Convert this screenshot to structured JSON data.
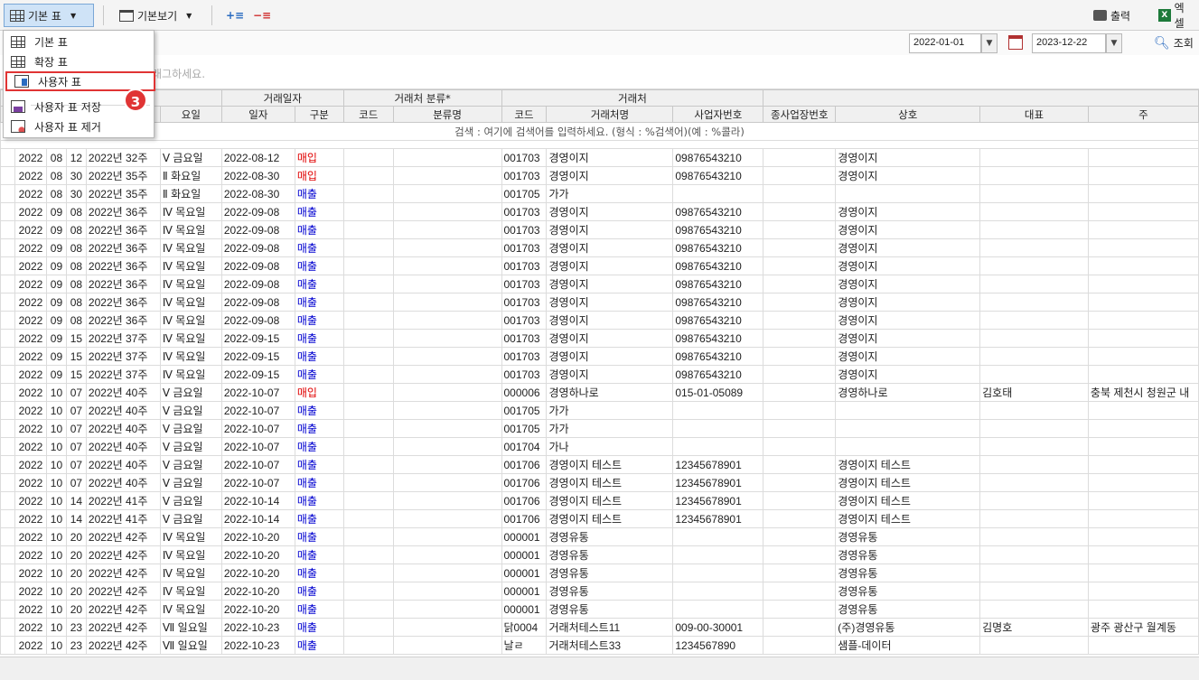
{
  "toolbar": {
    "table_mode_label": "기본 표",
    "view_label": "기본보기",
    "print_label": "출력",
    "excel_label": "엑셀"
  },
  "menu": {
    "items": [
      {
        "label": "기본 표"
      },
      {
        "label": "확장 표"
      },
      {
        "label": "사용자 표"
      },
      {
        "label": "사용자 표 저장"
      },
      {
        "label": "사용자 표 제거"
      }
    ],
    "step_badge": "3"
  },
  "filters": {
    "date_from": "2022-01-01",
    "date_to": "2023-12-22",
    "search_label": "조회"
  },
  "hint_partial": "래그하세요.",
  "grid": {
    "group_headers": {
      "trade_date": "거래일자",
      "partner_category": "거래처 분류*",
      "partner": "거래처"
    },
    "columns": [
      "",
      "",
      "",
      "요일",
      "일자",
      "구분",
      "코드",
      "분류명",
      "코드",
      "거래처명",
      "사업자번호",
      "종사업장번호",
      "상호",
      "대표",
      "주"
    ],
    "search_hint": "검색 : 여기에 검색어를 입력하세요. (형식 : %검색어)(예 : %콜라)",
    "rows": [
      [
        "2022",
        "08",
        "12",
        "2022년 32주",
        "Ⅴ 금요일",
        "2022-08-12",
        "매입",
        "",
        "",
        "001703",
        "경영이지",
        "09876543210",
        "",
        "경영이지",
        "",
        ""
      ],
      [
        "2022",
        "08",
        "30",
        "2022년 35주",
        "Ⅱ 화요일",
        "2022-08-30",
        "매입",
        "",
        "",
        "001703",
        "경영이지",
        "09876543210",
        "",
        "경영이지",
        "",
        ""
      ],
      [
        "2022",
        "08",
        "30",
        "2022년 35주",
        "Ⅱ 화요일",
        "2022-08-30",
        "매출",
        "",
        "",
        "001705",
        "가가",
        "",
        "",
        "",
        "",
        ""
      ],
      [
        "2022",
        "09",
        "08",
        "2022년 36주",
        "Ⅳ 목요일",
        "2022-09-08",
        "매출",
        "",
        "",
        "001703",
        "경영이지",
        "09876543210",
        "",
        "경영이지",
        "",
        ""
      ],
      [
        "2022",
        "09",
        "08",
        "2022년 36주",
        "Ⅳ 목요일",
        "2022-09-08",
        "매출",
        "",
        "",
        "001703",
        "경영이지",
        "09876543210",
        "",
        "경영이지",
        "",
        ""
      ],
      [
        "2022",
        "09",
        "08",
        "2022년 36주",
        "Ⅳ 목요일",
        "2022-09-08",
        "매출",
        "",
        "",
        "001703",
        "경영이지",
        "09876543210",
        "",
        "경영이지",
        "",
        ""
      ],
      [
        "2022",
        "09",
        "08",
        "2022년 36주",
        "Ⅳ 목요일",
        "2022-09-08",
        "매출",
        "",
        "",
        "001703",
        "경영이지",
        "09876543210",
        "",
        "경영이지",
        "",
        ""
      ],
      [
        "2022",
        "09",
        "08",
        "2022년 36주",
        "Ⅳ 목요일",
        "2022-09-08",
        "매출",
        "",
        "",
        "001703",
        "경영이지",
        "09876543210",
        "",
        "경영이지",
        "",
        ""
      ],
      [
        "2022",
        "09",
        "08",
        "2022년 36주",
        "Ⅳ 목요일",
        "2022-09-08",
        "매출",
        "",
        "",
        "001703",
        "경영이지",
        "09876543210",
        "",
        "경영이지",
        "",
        ""
      ],
      [
        "2022",
        "09",
        "08",
        "2022년 36주",
        "Ⅳ 목요일",
        "2022-09-08",
        "매출",
        "",
        "",
        "001703",
        "경영이지",
        "09876543210",
        "",
        "경영이지",
        "",
        ""
      ],
      [
        "2022",
        "09",
        "15",
        "2022년 37주",
        "Ⅳ 목요일",
        "2022-09-15",
        "매출",
        "",
        "",
        "001703",
        "경영이지",
        "09876543210",
        "",
        "경영이지",
        "",
        ""
      ],
      [
        "2022",
        "09",
        "15",
        "2022년 37주",
        "Ⅳ 목요일",
        "2022-09-15",
        "매출",
        "",
        "",
        "001703",
        "경영이지",
        "09876543210",
        "",
        "경영이지",
        "",
        ""
      ],
      [
        "2022",
        "09",
        "15",
        "2022년 37주",
        "Ⅳ 목요일",
        "2022-09-15",
        "매출",
        "",
        "",
        "001703",
        "경영이지",
        "09876543210",
        "",
        "경영이지",
        "",
        ""
      ],
      [
        "2022",
        "10",
        "07",
        "2022년 40주",
        "Ⅴ 금요일",
        "2022-10-07",
        "매입",
        "",
        "",
        "000006",
        "경영하나로",
        "015-01-05089",
        "",
        "경영하나로",
        "김호태",
        "충북 제천시 청원군 내"
      ],
      [
        "2022",
        "10",
        "07",
        "2022년 40주",
        "Ⅴ 금요일",
        "2022-10-07",
        "매출",
        "",
        "",
        "001705",
        "가가",
        "",
        "",
        "",
        "",
        ""
      ],
      [
        "2022",
        "10",
        "07",
        "2022년 40주",
        "Ⅴ 금요일",
        "2022-10-07",
        "매출",
        "",
        "",
        "001705",
        "가가",
        "",
        "",
        "",
        "",
        ""
      ],
      [
        "2022",
        "10",
        "07",
        "2022년 40주",
        "Ⅴ 금요일",
        "2022-10-07",
        "매출",
        "",
        "",
        "001704",
        "가나",
        "",
        "",
        "",
        "",
        ""
      ],
      [
        "2022",
        "10",
        "07",
        "2022년 40주",
        "Ⅴ 금요일",
        "2022-10-07",
        "매출",
        "",
        "",
        "001706",
        "경영이지 테스트",
        "12345678901",
        "",
        "경영이지 테스트",
        "",
        ""
      ],
      [
        "2022",
        "10",
        "07",
        "2022년 40주",
        "Ⅴ 금요일",
        "2022-10-07",
        "매출",
        "",
        "",
        "001706",
        "경영이지 테스트",
        "12345678901",
        "",
        "경영이지 테스트",
        "",
        ""
      ],
      [
        "2022",
        "10",
        "14",
        "2022년 41주",
        "Ⅴ 금요일",
        "2022-10-14",
        "매출",
        "",
        "",
        "001706",
        "경영이지 테스트",
        "12345678901",
        "",
        "경영이지 테스트",
        "",
        ""
      ],
      [
        "2022",
        "10",
        "14",
        "2022년 41주",
        "Ⅴ 금요일",
        "2022-10-14",
        "매출",
        "",
        "",
        "001706",
        "경영이지 테스트",
        "12345678901",
        "",
        "경영이지 테스트",
        "",
        ""
      ],
      [
        "2022",
        "10",
        "20",
        "2022년 42주",
        "Ⅳ 목요일",
        "2022-10-20",
        "매출",
        "",
        "",
        "000001",
        "경영유통",
        "",
        "",
        "경영유통",
        "",
        ""
      ],
      [
        "2022",
        "10",
        "20",
        "2022년 42주",
        "Ⅳ 목요일",
        "2022-10-20",
        "매출",
        "",
        "",
        "000001",
        "경영유통",
        "",
        "",
        "경영유통",
        "",
        ""
      ],
      [
        "2022",
        "10",
        "20",
        "2022년 42주",
        "Ⅳ 목요일",
        "2022-10-20",
        "매출",
        "",
        "",
        "000001",
        "경영유통",
        "",
        "",
        "경영유통",
        "",
        ""
      ],
      [
        "2022",
        "10",
        "20",
        "2022년 42주",
        "Ⅳ 목요일",
        "2022-10-20",
        "매출",
        "",
        "",
        "000001",
        "경영유통",
        "",
        "",
        "경영유통",
        "",
        ""
      ],
      [
        "2022",
        "10",
        "20",
        "2022년 42주",
        "Ⅳ 목요일",
        "2022-10-20",
        "매출",
        "",
        "",
        "000001",
        "경영유통",
        "",
        "",
        "경영유통",
        "",
        ""
      ],
      [
        "2022",
        "10",
        "23",
        "2022년 42주",
        "Ⅶ 일요일",
        "2022-10-23",
        "매출",
        "",
        "",
        "닭0004",
        "거래처테스트11",
        "009-00-30001",
        "",
        "(주)경영유통",
        "김명호",
        "광주 광산구 월계동"
      ],
      [
        "2022",
        "10",
        "23",
        "2022년 42주",
        "Ⅶ 일요일",
        "2022-10-23",
        "매출",
        "",
        "",
        "날ㄹ",
        "거래처테스트33",
        "1234567890",
        "",
        "샘플-데이터",
        "",
        ""
      ]
    ]
  },
  "colors": {
    "buy": "#e00000",
    "sell": "#0000d0",
    "highlight": "#e03434"
  }
}
